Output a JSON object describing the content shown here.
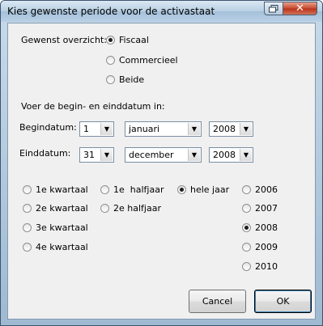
{
  "window": {
    "title": "Kies gewenste periode voor de activastaat",
    "close_glyph": "✕"
  },
  "overview": {
    "label": "Gewenst overzicht:",
    "options": [
      {
        "label": "Fiscaal",
        "checked": true
      },
      {
        "label": "Commercieel",
        "checked": false
      },
      {
        "label": "Beide",
        "checked": false
      }
    ]
  },
  "dates": {
    "instruction": "Voer de begin- en einddatum in:",
    "begin": {
      "label": "Begindatum:",
      "day": "1",
      "month": "januari",
      "year": "2008"
    },
    "end": {
      "label": "Einddatum:",
      "day": "31",
      "month": "december",
      "year": "2008"
    }
  },
  "periods": {
    "quarters": [
      "1e kwartaal",
      "2e kwartaal",
      "3e kwartaal",
      "4e kwartaal"
    ],
    "halves": [
      "1e  halfjaar",
      "2e halfjaar"
    ],
    "whole_year": {
      "label": "hele jaar",
      "checked": true
    },
    "years": [
      {
        "label": "2006",
        "checked": false
      },
      {
        "label": "2007",
        "checked": false
      },
      {
        "label": "2008",
        "checked": true
      },
      {
        "label": "2009",
        "checked": false
      },
      {
        "label": "2010",
        "checked": false
      }
    ]
  },
  "buttons": {
    "cancel": "Cancel",
    "ok": "OK"
  }
}
